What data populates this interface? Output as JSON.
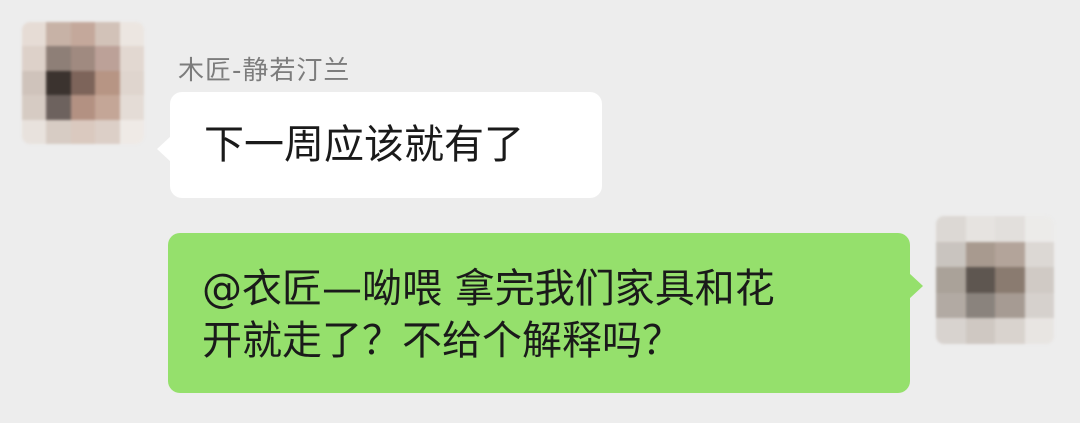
{
  "incoming": {
    "sender_name": "木匠-静若汀兰",
    "message": "下一周应该就有了"
  },
  "outgoing": {
    "lines": [
      "@衣匠—呦喂  拿完我们家具和花",
      "开就走了？不给个解释吗？"
    ]
  },
  "colors": {
    "background": "#ededed",
    "incoming_bubble": "#ffffff",
    "outgoing_bubble": "#95e06c",
    "sender_name": "#7c7c7c",
    "text": "#1a1a1a"
  },
  "avatars": {
    "left_pixels": [
      "#e6dcd5",
      "#c7b2a6",
      "#c4a89b",
      "#d2c2b8",
      "#ece6e1",
      "#ddd1c9",
      "#8e7f77",
      "#a08a80",
      "#bca198",
      "#e2d8d1",
      "#cfc3bb",
      "#3b332f",
      "#7d645a",
      "#b79584",
      "#dfd5ce",
      "#d6cbc3",
      "#6d625e",
      "#b39182",
      "#c4a697",
      "#e4dcd6",
      "#e8e2dd",
      "#d7ccc4",
      "#dac9bf",
      "#dccfc7",
      "#efeae6"
    ],
    "right_pixels": [
      "#dcd8d4",
      "#e6e3e0",
      "#e2dfdc",
      "#ecebe9",
      "#c9c4bf",
      "#a89a8f",
      "#b3a49a",
      "#dcd8d4",
      "#aaa299",
      "#5e5650",
      "#8a7b70",
      "#d0cac5",
      "#b2aaa3",
      "#8a837d",
      "#a69b93",
      "#d6d1cd",
      "#d8d3cf",
      "#cfc8c2",
      "#d9d3ce",
      "#e8e5e2"
    ]
  }
}
